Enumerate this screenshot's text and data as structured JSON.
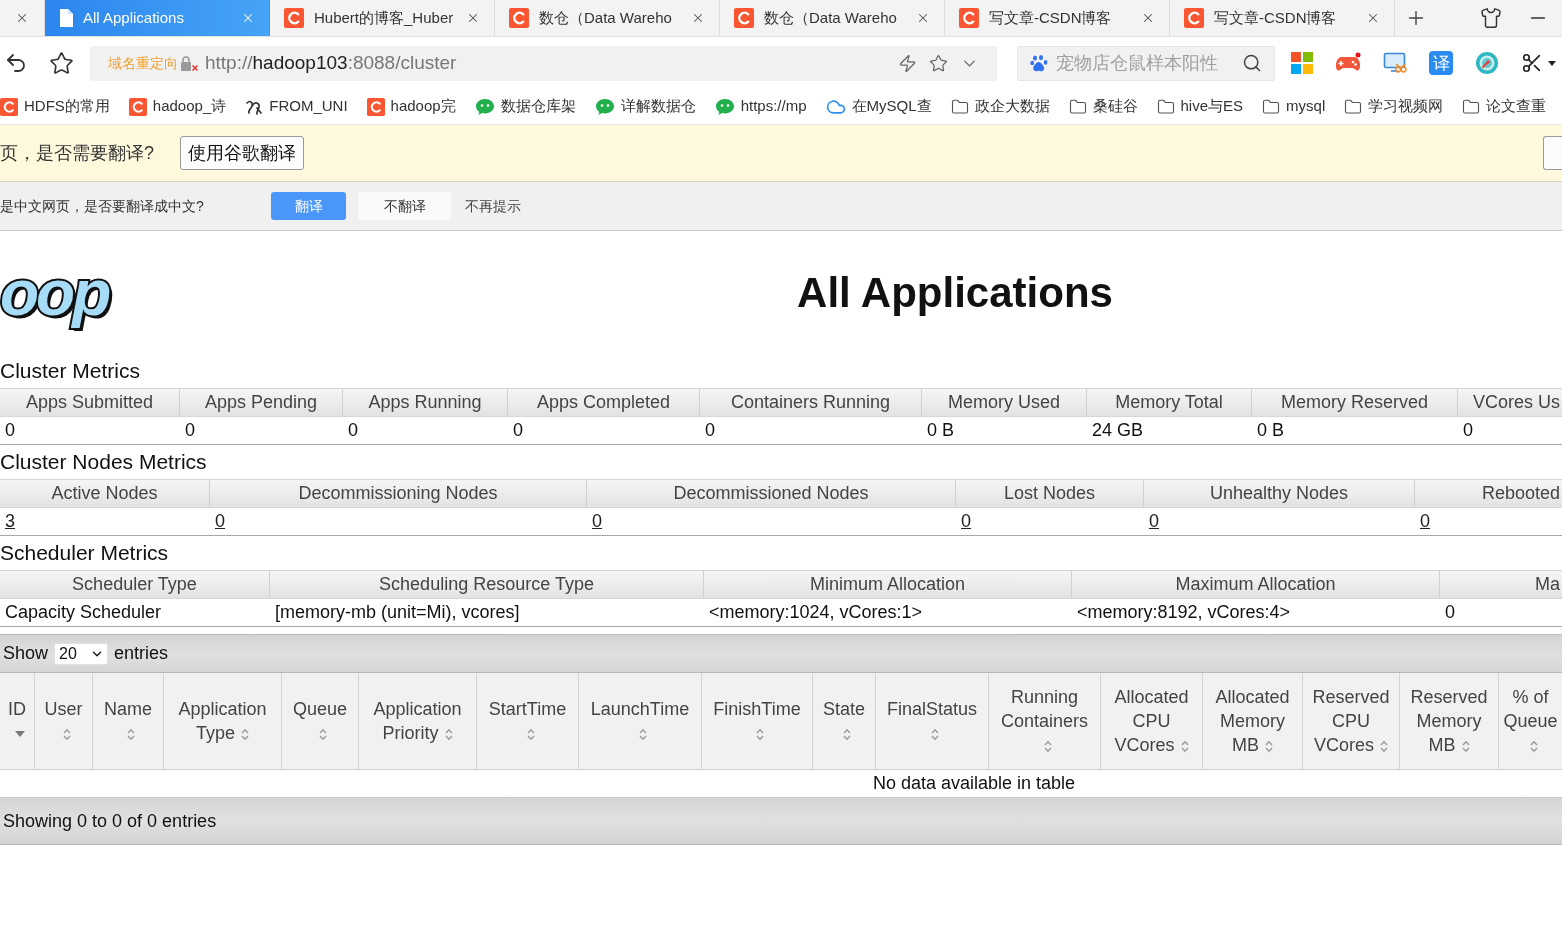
{
  "browser": {
    "tabs": [
      {
        "selected": false
      },
      {
        "title": "All Applications",
        "kind": "page",
        "selected": true
      },
      {
        "title": "Hubert的博客_Huber",
        "kind": "site",
        "selected": false
      },
      {
        "title": "数仓（Data Wareho",
        "kind": "site",
        "selected": false
      },
      {
        "title": "数仓（Data Wareho",
        "kind": "site",
        "selected": false
      },
      {
        "title": "写文章-CSDN博客",
        "kind": "site",
        "selected": false
      },
      {
        "title": "写文章-CSDN博客",
        "kind": "site",
        "selected": false
      }
    ],
    "address_bar": {
      "notice": "域名重定向",
      "url_scheme": "http://",
      "url_host": "hadoop103",
      "url_path": ":8088/cluster"
    },
    "search": {
      "placeholder": "宠物店仓鼠样本阳性"
    },
    "extensions": [
      {
        "kind": "tiles"
      },
      {
        "kind": "gamepad"
      },
      {
        "kind": "monitor"
      },
      {
        "kind": "badge",
        "label": "译"
      },
      {
        "kind": "ring"
      },
      {
        "kind": "scissors"
      }
    ],
    "bookmarks": [
      {
        "kind": "site",
        "label": "HDFS的常用"
      },
      {
        "kind": "site",
        "label": "hadoop_诗"
      },
      {
        "kind": "pen",
        "label": "FROM_UNI"
      },
      {
        "kind": "site",
        "label": "hadoop完"
      },
      {
        "kind": "chat",
        "label": "数据仓库架"
      },
      {
        "kind": "chat",
        "label": "详解数据仓"
      },
      {
        "kind": "chat",
        "label": "https://mp"
      },
      {
        "kind": "cloud",
        "label": "在MySQL查"
      },
      {
        "kind": "folder",
        "label": "政企大数据"
      },
      {
        "kind": "folder",
        "label": "桑硅谷"
      },
      {
        "kind": "folder",
        "label": "hive与ES"
      },
      {
        "kind": "folder",
        "label": "mysql"
      },
      {
        "kind": "folder",
        "label": "学习视频网"
      },
      {
        "kind": "folder",
        "label": "论文查重"
      }
    ]
  },
  "translate_prompt": {
    "message": "页，是否需要翻译?",
    "button": "使用谷歌翻译"
  },
  "translate_bar": {
    "message": "是中文网页，是否要翻译成中文?",
    "buttons": [
      {
        "label": "翻译",
        "primary": true
      },
      {
        "label": "不翻译",
        "primary": false
      }
    ],
    "dismiss": "不再提示"
  },
  "page": {
    "logo_text": "oop",
    "title": "All Applications",
    "metrics": [
      {
        "title": "Cluster Metrics",
        "kind": "plain",
        "columns": [
          "Apps Submitted",
          "Apps Pending",
          "Apps Running",
          "Apps Completed",
          "Containers Running",
          "Memory Used",
          "Memory Total",
          "Memory Reserved",
          "VCores Us"
        ],
        "values": [
          "0",
          "0",
          "0",
          "0",
          "0",
          "0 B",
          "24 GB",
          "0 B",
          "0"
        ]
      },
      {
        "title": "Cluster Nodes Metrics",
        "kind": "links",
        "columns": [
          "Active Nodes",
          "Decommissioning Nodes",
          "Decommissioned Nodes",
          "Lost Nodes",
          "Unhealthy Nodes",
          "Rebooted"
        ],
        "values": [
          "3",
          "0",
          "0",
          "0",
          "0",
          "0"
        ]
      },
      {
        "title": "Scheduler Metrics",
        "kind": "plain",
        "columns": [
          "Scheduler Type",
          "Scheduling Resource Type",
          "Minimum Allocation",
          "Maximum Allocation",
          "Ma"
        ],
        "values": [
          "Capacity Scheduler",
          "[memory-mb (unit=Mi), vcores]",
          "<memory:1024, vCores:1>",
          "<memory:8192, vCores:4>",
          "0"
        ]
      }
    ],
    "applications": {
      "show_label": "Show",
      "page_size": "20",
      "entries_label": "entries",
      "columns": [
        {
          "label": "ID",
          "sorted": true
        },
        {
          "label": "User",
          "sorted": false
        },
        {
          "label": "Name",
          "sorted": false
        },
        {
          "label": "Application Type",
          "sorted": false
        },
        {
          "label": "Queue",
          "sorted": false
        },
        {
          "label": "Application Priority",
          "sorted": false
        },
        {
          "label": "StartTime",
          "sorted": false
        },
        {
          "label": "LaunchTime",
          "sorted": false
        },
        {
          "label": "FinishTime",
          "sorted": false
        },
        {
          "label": "State",
          "sorted": false
        },
        {
          "label": "FinalStatus",
          "sorted": false
        },
        {
          "label": "Running Containers",
          "sorted": false
        },
        {
          "label": "Allocated CPU VCores",
          "sorted": false
        },
        {
          "label": "Allocated Memory MB",
          "sorted": false
        },
        {
          "label": "Reserved CPU VCores",
          "sorted": false
        },
        {
          "label": "Reserved Memory MB",
          "sorted": false
        },
        {
          "label": "% of Queue",
          "sorted": false
        }
      ],
      "empty_message": "No data available in table",
      "info": "Showing 0 to 0 of 0 entries"
    }
  }
}
